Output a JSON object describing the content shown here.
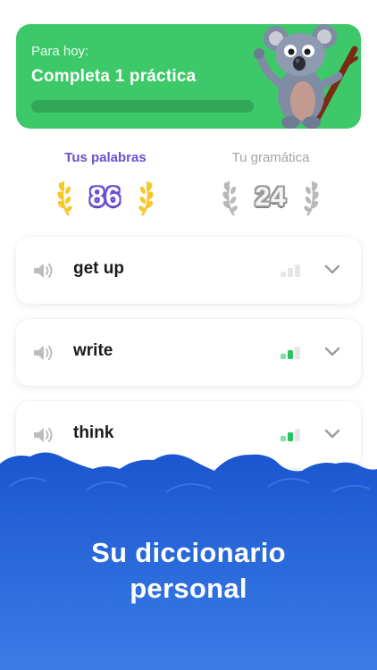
{
  "today": {
    "caption": "Para hoy:",
    "headline": "Completa 1 práctica",
    "progress": 0
  },
  "stats": {
    "words_label": "Tus palabras",
    "words_count": "86",
    "grammar_label": "Tu gramática",
    "grammar_count": "24"
  },
  "words": [
    {
      "word": "get up",
      "level": 0
    },
    {
      "word": "write",
      "level": 2
    },
    {
      "word": "think",
      "level": 2
    }
  ],
  "promo": {
    "line1": "Su diccionario",
    "line2": "personal"
  },
  "colors": {
    "green": "#3dc96a",
    "purple": "#6c4fd1",
    "blue": "#1f5fd6",
    "gold": "#f5c92c"
  }
}
